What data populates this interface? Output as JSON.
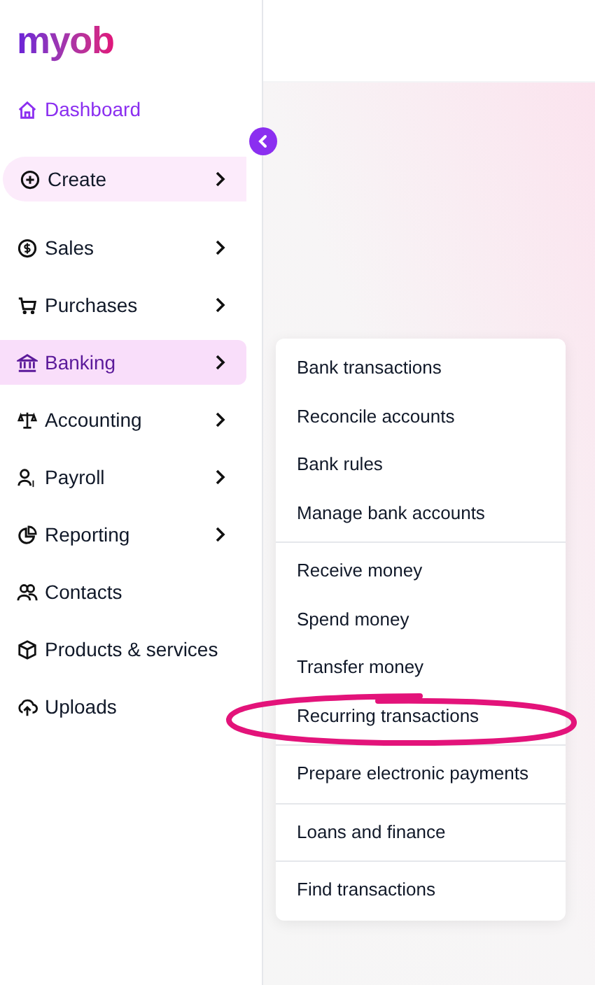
{
  "logo": "myob",
  "nav": [
    {
      "label": "Dashboard",
      "kind": "home",
      "has_submenu": false,
      "selected": false
    },
    {
      "label": "Create",
      "kind": "pill",
      "has_submenu": true,
      "selected": false
    },
    {
      "label": "Sales",
      "kind": "item",
      "has_submenu": true,
      "selected": false
    },
    {
      "label": "Purchases",
      "kind": "item",
      "has_submenu": true,
      "selected": false
    },
    {
      "label": "Banking",
      "kind": "item",
      "has_submenu": true,
      "selected": true
    },
    {
      "label": "Accounting",
      "kind": "item",
      "has_submenu": true,
      "selected": false
    },
    {
      "label": "Payroll",
      "kind": "item",
      "has_submenu": true,
      "selected": false
    },
    {
      "label": "Reporting",
      "kind": "item",
      "has_submenu": true,
      "selected": false
    },
    {
      "label": "Contacts",
      "kind": "item",
      "has_submenu": false,
      "selected": false
    },
    {
      "label": "Products & services",
      "kind": "item",
      "has_submenu": false,
      "selected": false
    },
    {
      "label": "Uploads",
      "kind": "item",
      "has_submenu": false,
      "selected": false
    }
  ],
  "submenu": [
    [
      "Bank transactions",
      "Reconcile accounts",
      "Bank rules",
      "Manage bank accounts"
    ],
    [
      "Receive money",
      "Spend money",
      "Transfer money",
      "Recurring transactions"
    ],
    [
      "Prepare electronic payments"
    ],
    [
      "Loans and finance"
    ],
    [
      "Find transactions"
    ]
  ]
}
